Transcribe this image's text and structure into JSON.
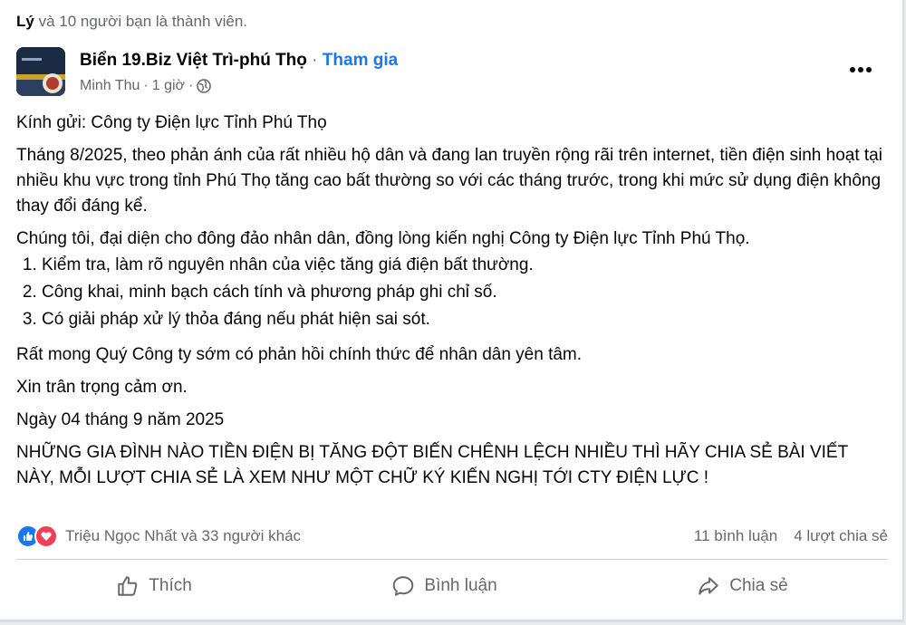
{
  "members_line": {
    "name": "Lý",
    "rest": " và 10 người bạn là thành viên."
  },
  "header": {
    "group_name": "Biển 19.Biz Việt Trì-phú Thọ",
    "separator": " · ",
    "join_label": "Tham gia",
    "author": "Minh Thu",
    "time": "1 giờ",
    "dot": "·"
  },
  "post": {
    "greeting": "Kính gửi: Công ty Điện lực Tỉnh Phú Thọ",
    "paragraph1": "Tháng 8/2025, theo phản ánh của rất nhiều hộ dân và đang lan truyền rộng rãi trên internet, tiền điện sinh hoạt tại nhiều khu vực trong tỉnh Phú Thọ tăng cao bất thường so với các tháng trước, trong khi mức sử dụng điện không thay đổi đáng kể.",
    "paragraph2": "Chúng tôi, đại diện cho đông đảo nhân dân, đồng lòng kiến nghị Công ty Điện lực Tỉnh Phú Thọ.",
    "requests": [
      "Kiểm tra, làm rõ nguyên nhân của việc tăng giá điện bất thường.",
      "Công khai, minh bạch cách tính và phương pháp ghi chỉ số.",
      "Có giải pháp xử lý thỏa đáng nếu phát hiện sai sót."
    ],
    "paragraph3": "Rất mong Quý Công ty sớm có phản hồi chính thức để nhân dân yên tâm.",
    "thanks": "Xin trân trọng cảm ơn.",
    "date": "Ngày 04 tháng 9 năm 2025",
    "call_to_action": "NHỮNG GIA ĐÌNH NÀO TIỀN ĐIỆN BỊ TĂNG ĐỘT BIẾN CHÊNH LỆCH NHIỀU THÌ HÃY CHIA SẺ BÀI VIẾT NÀY, MỖI LƯỢT CHIA SẺ LÀ XEM NHƯ MỘT CHỮ KÝ KIẾN NGHỊ TỚI CTY ĐIỆN LỰC !"
  },
  "stats": {
    "reactors": "Triệu Ngọc Nhất và 33 người khác",
    "comments": "11 bình luận",
    "shares": "4 lượt chia sẻ"
  },
  "actions": {
    "like": "Thích",
    "comment": "Bình luận",
    "share": "Chia sẻ"
  },
  "icons": {
    "globe": "globe-icon",
    "more": "more-options-icon",
    "like_reaction": "thumbs-up-icon",
    "love_reaction": "heart-icon",
    "like_action": "thumbs-up-outline-icon",
    "comment_action": "speech-bubble-icon",
    "share_action": "share-arrow-icon"
  },
  "colors": {
    "accent": "#1877f2",
    "secondary_text": "#65676b",
    "love": "#f33e58"
  }
}
